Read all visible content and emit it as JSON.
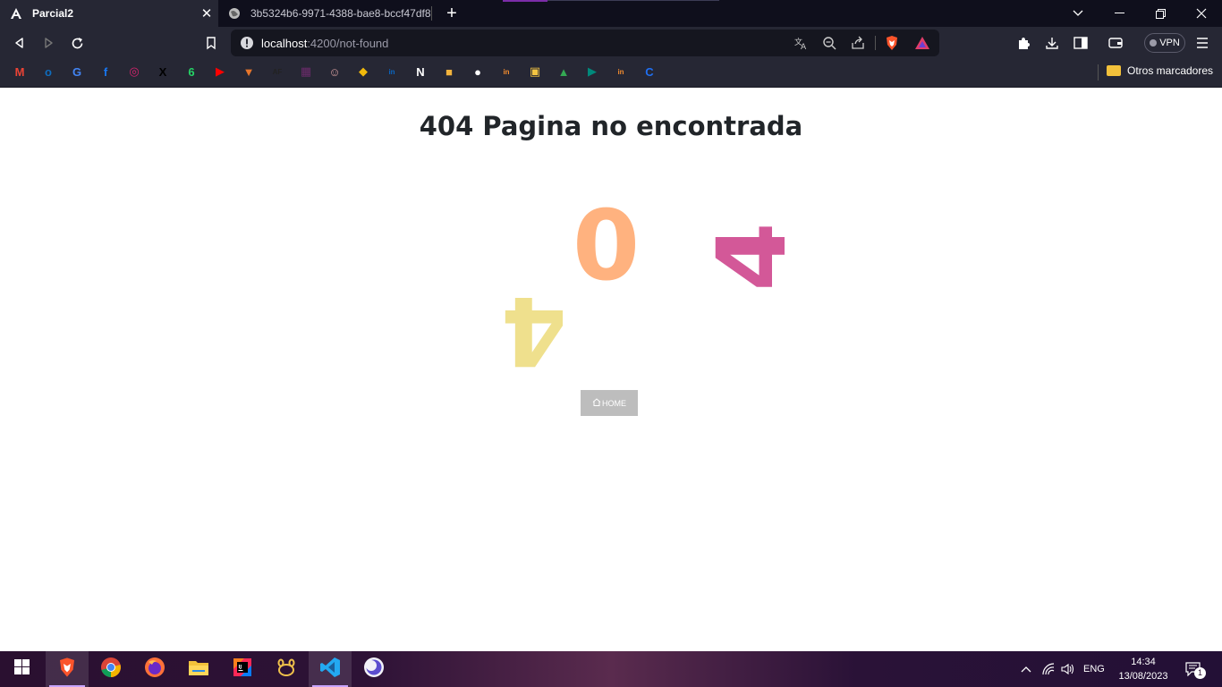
{
  "tabs": [
    {
      "title": "Parcial2",
      "active": true,
      "icon": "angular-icon"
    },
    {
      "title": "3b5324b6-9971-4388-bae8-bccf47df8",
      "active": false,
      "icon": "globe-icon"
    }
  ],
  "address_bar": {
    "host": "localhost",
    "path": ":4200/not-found"
  },
  "toolbar": {
    "vpn_label": "VPN"
  },
  "bookmarks": {
    "items": [
      {
        "name": "gmail",
        "icon": "gmail-icon",
        "glyph": "M",
        "color": "#ea4335"
      },
      {
        "name": "outlook",
        "icon": "outlook-icon",
        "glyph": "o",
        "color": "#0f6cbd"
      },
      {
        "name": "google",
        "icon": "google-icon",
        "glyph": "G",
        "color": "#4285f4"
      },
      {
        "name": "facebook",
        "icon": "facebook-icon",
        "glyph": "f",
        "color": "#1877f2"
      },
      {
        "name": "instagram",
        "icon": "instagram-icon",
        "glyph": "◎",
        "color": "#d6246e"
      },
      {
        "name": "x",
        "icon": "x-icon",
        "glyph": "X",
        "color": "#000000"
      },
      {
        "name": "whatsapp",
        "icon": "whatsapp-icon",
        "glyph": "6",
        "color": "#25d366"
      },
      {
        "name": "youtube",
        "icon": "youtube-icon",
        "glyph": "▶",
        "color": "#ff0000"
      },
      {
        "name": "app-8",
        "icon": "fox-icon",
        "glyph": "▼",
        "color": "#e8762b"
      },
      {
        "name": "af",
        "icon": "af-icon",
        "glyph": "AF",
        "color": "#222222"
      },
      {
        "name": "app-10",
        "icon": "anime-icon",
        "glyph": "▦",
        "color": "#6b2b6b"
      },
      {
        "name": "app-11",
        "icon": "character-icon",
        "glyph": "☺",
        "color": "#d9a0a0"
      },
      {
        "name": "binance",
        "icon": "binance-icon",
        "glyph": "◆",
        "color": "#f0b90b"
      },
      {
        "name": "linkedin",
        "icon": "linkedin-icon",
        "glyph": "in",
        "color": "#0a66c2"
      },
      {
        "name": "notion",
        "icon": "notion-icon",
        "glyph": "N",
        "color": "#ffffff"
      },
      {
        "name": "app-15",
        "icon": "box-icon",
        "glyph": "■",
        "color": "#f2b33d"
      },
      {
        "name": "github",
        "icon": "github-icon",
        "glyph": "●",
        "color": "#ffffff"
      },
      {
        "name": "invision-1",
        "icon": "invision-icon",
        "glyph": "in",
        "color": "#f28b2e"
      },
      {
        "name": "app-18",
        "icon": "image-icon",
        "glyph": "▣",
        "color": "#f4c542"
      },
      {
        "name": "drive",
        "icon": "drive-icon",
        "glyph": "▲",
        "color": "#34a853"
      },
      {
        "name": "meet",
        "icon": "meet-icon",
        "glyph": "▶",
        "color": "#00897b"
      },
      {
        "name": "invision-2",
        "icon": "invision-icon",
        "glyph": "in",
        "color": "#f28b2e"
      },
      {
        "name": "canva",
        "icon": "canva-icon",
        "glyph": "C",
        "color": "#1f6ff2"
      }
    ],
    "other_label": "Otros marcadores"
  },
  "page": {
    "title": "404 Pagina no encontrada",
    "digits": [
      "4",
      "0",
      "4"
    ],
    "digit_colors": {
      "first_four": "#efe08d",
      "zero": "#ffb27f",
      "second_four": "#d35898"
    },
    "home_button_label": "HOME",
    "home_button_icon": "home-icon"
  },
  "taskbar": {
    "apps": [
      {
        "name": "start",
        "icon": "windows-icon"
      },
      {
        "name": "brave",
        "icon": "brave-icon",
        "active": true
      },
      {
        "name": "chrome",
        "icon": "chrome-icon"
      },
      {
        "name": "firefox",
        "icon": "firefox-icon"
      },
      {
        "name": "file-explorer",
        "icon": "folder-icon"
      },
      {
        "name": "intellij",
        "icon": "intellij-icon"
      },
      {
        "name": "app-7",
        "icon": "paw-icon"
      },
      {
        "name": "vscode",
        "icon": "vscode-icon",
        "active": true
      },
      {
        "name": "app-9",
        "icon": "moon-icon"
      }
    ],
    "language": "ENG",
    "time": "14:34",
    "date": "13/08/2023",
    "notifications": "1"
  }
}
